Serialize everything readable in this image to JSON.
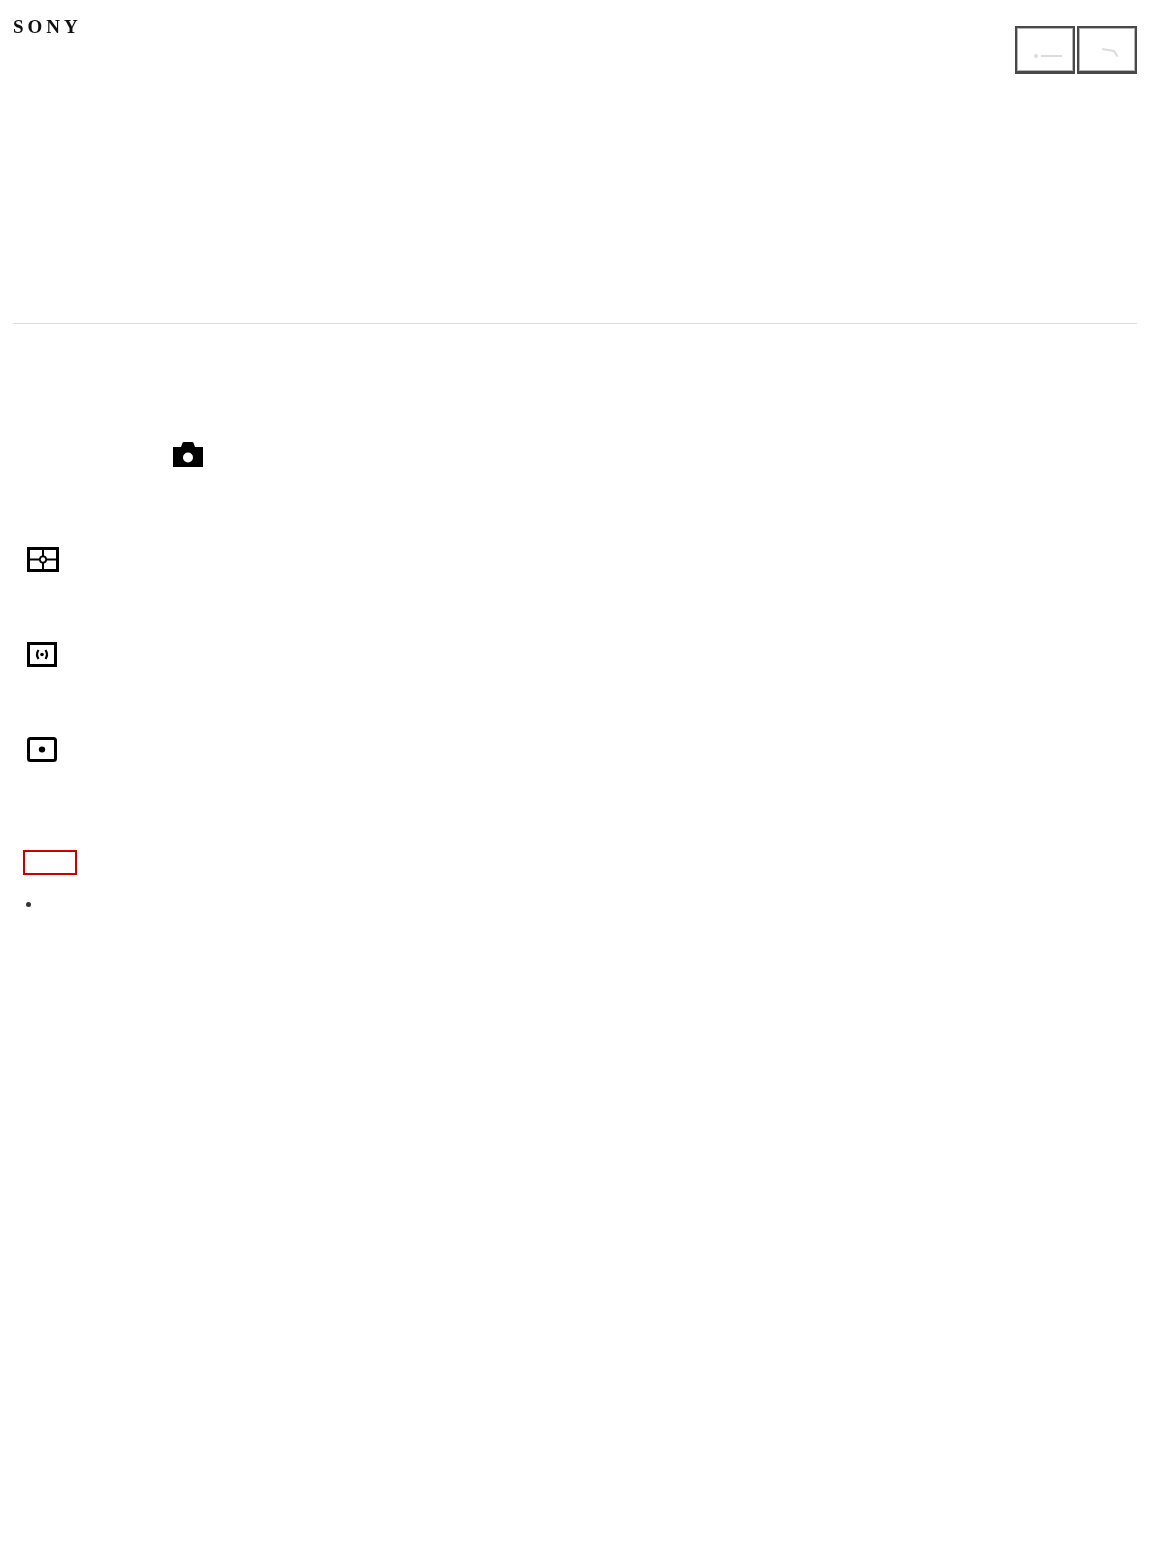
{
  "header": {
    "logo": "SONY",
    "buttons": [
      {
        "kind": "dash"
      },
      {
        "kind": "slash"
      }
    ]
  },
  "mode_icon": {
    "kind": "camera"
  },
  "icon_rows": [
    {
      "kind": "frame_target"
    },
    {
      "kind": "frame_brackets"
    },
    {
      "kind": "frame_dot"
    }
  ]
}
